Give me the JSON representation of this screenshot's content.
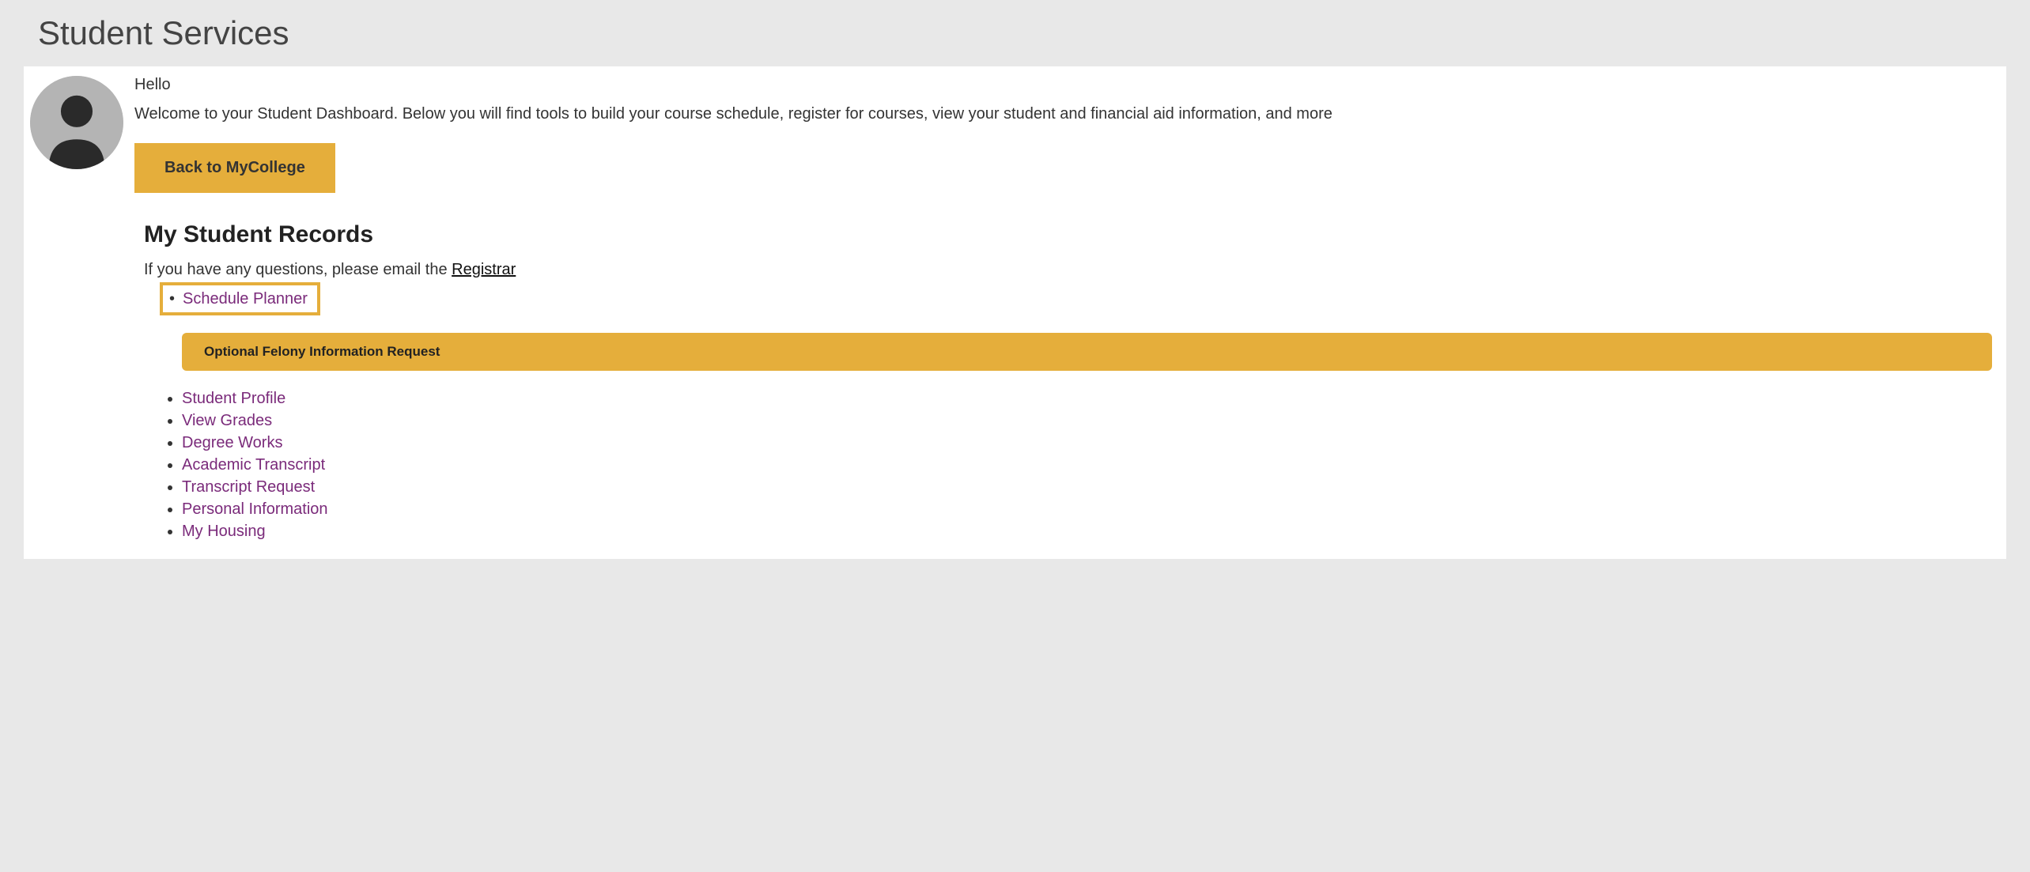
{
  "page": {
    "title": "Student Services"
  },
  "profile": {
    "greeting": "Hello",
    "welcome": "Welcome to your Student Dashboard. Below you will find tools to build your course schedule, register for courses, view your student and financial aid information, and more",
    "back_button": "Back to MyCollege"
  },
  "records": {
    "heading": "My Student Records",
    "questions_prefix": "If you have any questions, please email the ",
    "questions_link": "Registrar",
    "highlighted_link": "Schedule Planner",
    "banner_label": "Optional Felony Information Request",
    "links": [
      "Student Profile",
      "View Grades",
      "Degree Works",
      "Academic Transcript",
      "Transcript Request",
      "Personal Information",
      "My Housing"
    ]
  }
}
